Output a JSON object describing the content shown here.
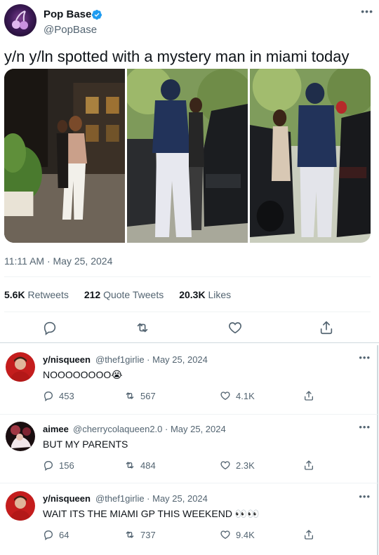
{
  "tweet": {
    "author_name": "Pop Base",
    "author_handle": "@PopBase",
    "verified": true,
    "text": "y/n y/ln spotted with a mystery man in miami today",
    "timestamp": "11:11 AM · May 25, 2024",
    "stats": {
      "retweets_count": "5.6K",
      "retweets_label": "Retweets",
      "quotes_count": "212",
      "quotes_label": "Quote Tweets",
      "likes_count": "20.3K",
      "likes_label": "Likes"
    },
    "more_label": "•••"
  },
  "replies": [
    {
      "name": "y/nisqueen",
      "handle_date": "@thef1girlie · May 25, 2024",
      "text": "NOOOOOOOO😭",
      "replies": "453",
      "retweets": "567",
      "likes": "4.1K"
    },
    {
      "name": "aimee",
      "handle_date": "@cherrycolaqueen2.0 · May 25, 2024",
      "text": "BUT MY PARENTS",
      "replies": "156",
      "retweets": "484",
      "likes": "2.3K"
    },
    {
      "name": "y/nisqueen",
      "handle_date": "@thef1girlie · May 25, 2024",
      "text": "WAIT ITS THE MIAMI GP THIS WEEKEND 👀👀",
      "replies": "64",
      "retweets": "737",
      "likes": "9.4K"
    }
  ],
  "colors": {
    "text_primary": "#0f1419",
    "text_secondary": "#536471",
    "verified_blue": "#1d9bf0",
    "divider": "#eff3f4"
  },
  "icons": [
    "verified-badge-icon",
    "reply-icon",
    "retweet-icon",
    "like-icon",
    "share-icon",
    "more-icon"
  ]
}
